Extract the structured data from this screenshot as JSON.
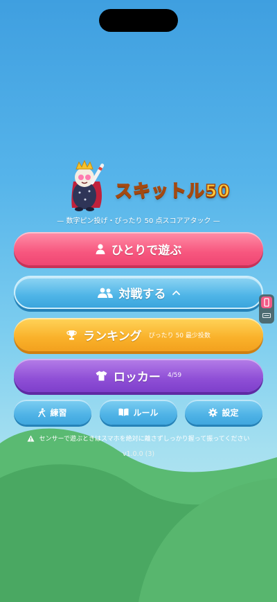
{
  "app": {
    "logo_text": "スキットル50",
    "tagline": "— 数字ピン投げ・ぴったり 50 点スコアアタック —"
  },
  "menu": {
    "solo": {
      "label": "ひとりで遊ぶ",
      "icon": "person-icon"
    },
    "versus": {
      "label": "対戦する",
      "icon": "people-icon",
      "chevron": "chevron-up-icon"
    },
    "ranking": {
      "label": "ランキング",
      "sub": "ぴったり 50 最少投数",
      "icon": "trophy-icon"
    },
    "locker": {
      "label": "ロッカー",
      "sub": "4/59",
      "icon": "shirt-icon"
    }
  },
  "small_buttons": {
    "practice": {
      "label": "練習",
      "icon": "running-person-icon"
    },
    "rules": {
      "label": "ルール",
      "icon": "book-icon"
    },
    "settings": {
      "label": "設定",
      "icon": "gear-icon"
    }
  },
  "warning": {
    "text": "センサーで遊ぶときはスマホを絶対に離さずしっかり握って振ってください",
    "icon": "warning-icon"
  },
  "version": "v1.0.0 (3)",
  "side_toggle": {
    "top_icon": "phone-icon",
    "bottom_icon": "keyboard-icon"
  },
  "colors": {
    "solo": "#f7577f",
    "versus": "#4fb5e7",
    "ranking": "#f9b12a",
    "locker": "#8f4fd6",
    "grass": "#4fb068"
  }
}
